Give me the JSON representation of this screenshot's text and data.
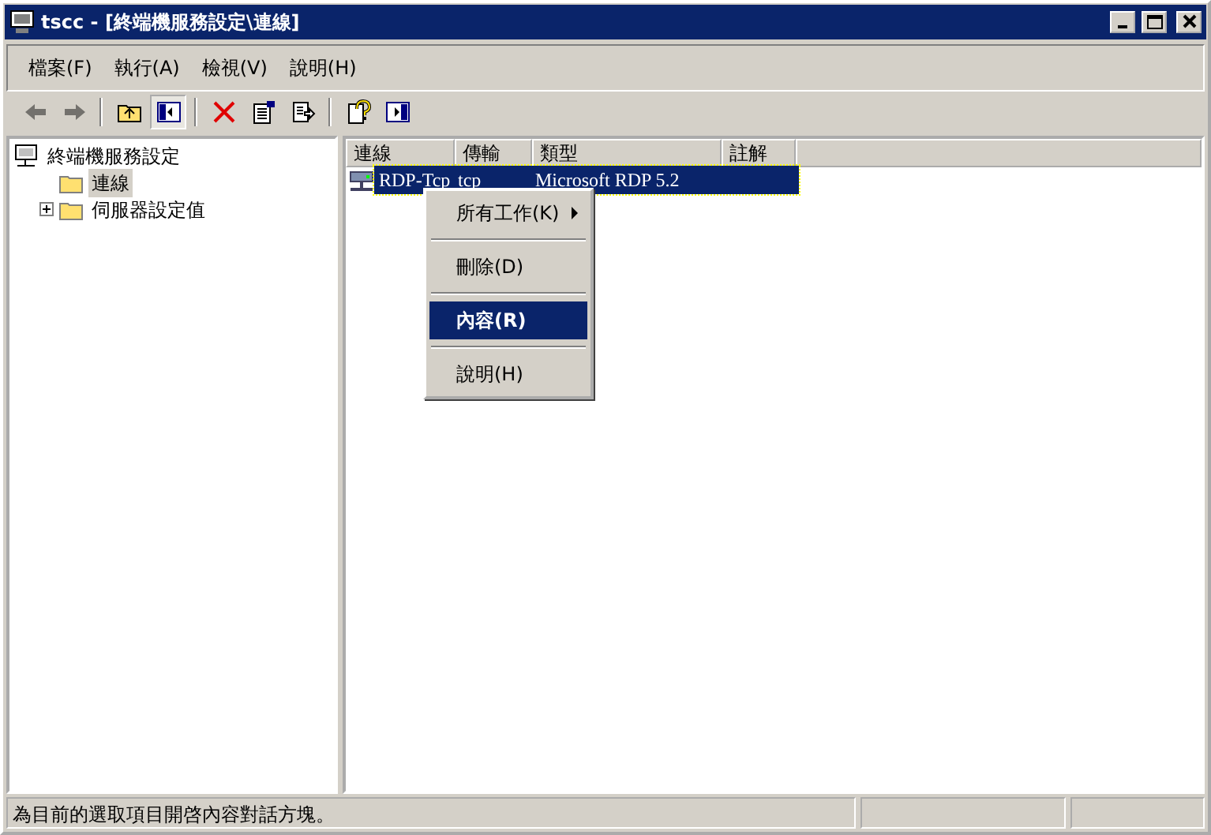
{
  "window": {
    "title": "tscc - [終端機服務設定\\連線]"
  },
  "menu": [
    {
      "label": "檔案(F)"
    },
    {
      "label": "執行(A)"
    },
    {
      "label": "檢視(V)"
    },
    {
      "label": "說明(H)"
    }
  ],
  "toolbar": [
    {
      "kind": "back",
      "disabled": true,
      "pressed": false
    },
    {
      "kind": "forward",
      "disabled": true,
      "pressed": false
    },
    {
      "kind": "separator"
    },
    {
      "kind": "up",
      "disabled": false,
      "pressed": false
    },
    {
      "kind": "tree",
      "disabled": false,
      "pressed": true
    },
    {
      "kind": "separator"
    },
    {
      "kind": "delete",
      "disabled": false,
      "pressed": false
    },
    {
      "kind": "properties",
      "disabled": false,
      "pressed": false
    },
    {
      "kind": "export",
      "disabled": false,
      "pressed": false
    },
    {
      "kind": "separator"
    },
    {
      "kind": "help",
      "disabled": false,
      "pressed": false
    },
    {
      "kind": "pane",
      "disabled": false,
      "pressed": false
    }
  ],
  "tree": [
    {
      "label": "終端機服務設定",
      "kind": "computer",
      "selected": false,
      "children": [
        {
          "label": "連線",
          "kind": "folder",
          "selected": true,
          "expanded": false
        },
        {
          "label": "伺服器設定值",
          "kind": "folder",
          "selected": false,
          "expanded": false,
          "collapsible": true
        }
      ]
    }
  ],
  "table": {
    "columns": [
      "連線",
      "傳輸",
      "類型",
      "註解"
    ],
    "rows": [
      {
        "cells": [
          "RDP-Tcp",
          "tcp",
          "Microsoft RDP 5.2"
        ],
        "selected": true
      }
    ]
  },
  "context_menu": [
    {
      "kind": "item",
      "label": "所有工作(K)",
      "submenu": true,
      "selected": false,
      "default": false
    },
    {
      "kind": "separator"
    },
    {
      "kind": "item",
      "label": "刪除(D)",
      "submenu": false,
      "selected": false,
      "default": false
    },
    {
      "kind": "separator"
    },
    {
      "kind": "item",
      "label": "內容(R)",
      "submenu": false,
      "selected": true,
      "default": true
    },
    {
      "kind": "separator"
    },
    {
      "kind": "item",
      "label": "說明(H)",
      "submenu": false,
      "selected": false,
      "default": false
    }
  ],
  "status_bar": [
    "為目前的選取項目開啓內容對話方塊。"
  ]
}
